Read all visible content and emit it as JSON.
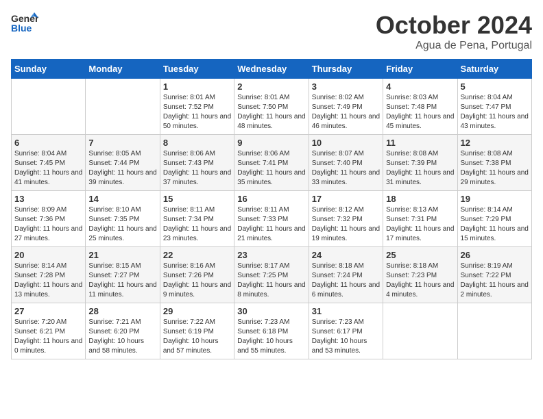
{
  "header": {
    "logo_general": "General",
    "logo_blue": "Blue",
    "month_title": "October 2024",
    "subtitle": "Agua de Pena, Portugal"
  },
  "days_of_week": [
    "Sunday",
    "Monday",
    "Tuesday",
    "Wednesday",
    "Thursday",
    "Friday",
    "Saturday"
  ],
  "weeks": [
    [
      {
        "day": "",
        "info": ""
      },
      {
        "day": "",
        "info": ""
      },
      {
        "day": "1",
        "info": "Sunrise: 8:01 AM\nSunset: 7:52 PM\nDaylight: 11 hours and 50 minutes."
      },
      {
        "day": "2",
        "info": "Sunrise: 8:01 AM\nSunset: 7:50 PM\nDaylight: 11 hours and 48 minutes."
      },
      {
        "day": "3",
        "info": "Sunrise: 8:02 AM\nSunset: 7:49 PM\nDaylight: 11 hours and 46 minutes."
      },
      {
        "day": "4",
        "info": "Sunrise: 8:03 AM\nSunset: 7:48 PM\nDaylight: 11 hours and 45 minutes."
      },
      {
        "day": "5",
        "info": "Sunrise: 8:04 AM\nSunset: 7:47 PM\nDaylight: 11 hours and 43 minutes."
      }
    ],
    [
      {
        "day": "6",
        "info": "Sunrise: 8:04 AM\nSunset: 7:45 PM\nDaylight: 11 hours and 41 minutes."
      },
      {
        "day": "7",
        "info": "Sunrise: 8:05 AM\nSunset: 7:44 PM\nDaylight: 11 hours and 39 minutes."
      },
      {
        "day": "8",
        "info": "Sunrise: 8:06 AM\nSunset: 7:43 PM\nDaylight: 11 hours and 37 minutes."
      },
      {
        "day": "9",
        "info": "Sunrise: 8:06 AM\nSunset: 7:41 PM\nDaylight: 11 hours and 35 minutes."
      },
      {
        "day": "10",
        "info": "Sunrise: 8:07 AM\nSunset: 7:40 PM\nDaylight: 11 hours and 33 minutes."
      },
      {
        "day": "11",
        "info": "Sunrise: 8:08 AM\nSunset: 7:39 PM\nDaylight: 11 hours and 31 minutes."
      },
      {
        "day": "12",
        "info": "Sunrise: 8:08 AM\nSunset: 7:38 PM\nDaylight: 11 hours and 29 minutes."
      }
    ],
    [
      {
        "day": "13",
        "info": "Sunrise: 8:09 AM\nSunset: 7:36 PM\nDaylight: 11 hours and 27 minutes."
      },
      {
        "day": "14",
        "info": "Sunrise: 8:10 AM\nSunset: 7:35 PM\nDaylight: 11 hours and 25 minutes."
      },
      {
        "day": "15",
        "info": "Sunrise: 8:11 AM\nSunset: 7:34 PM\nDaylight: 11 hours and 23 minutes."
      },
      {
        "day": "16",
        "info": "Sunrise: 8:11 AM\nSunset: 7:33 PM\nDaylight: 11 hours and 21 minutes."
      },
      {
        "day": "17",
        "info": "Sunrise: 8:12 AM\nSunset: 7:32 PM\nDaylight: 11 hours and 19 minutes."
      },
      {
        "day": "18",
        "info": "Sunrise: 8:13 AM\nSunset: 7:31 PM\nDaylight: 11 hours and 17 minutes."
      },
      {
        "day": "19",
        "info": "Sunrise: 8:14 AM\nSunset: 7:29 PM\nDaylight: 11 hours and 15 minutes."
      }
    ],
    [
      {
        "day": "20",
        "info": "Sunrise: 8:14 AM\nSunset: 7:28 PM\nDaylight: 11 hours and 13 minutes."
      },
      {
        "day": "21",
        "info": "Sunrise: 8:15 AM\nSunset: 7:27 PM\nDaylight: 11 hours and 11 minutes."
      },
      {
        "day": "22",
        "info": "Sunrise: 8:16 AM\nSunset: 7:26 PM\nDaylight: 11 hours and 9 minutes."
      },
      {
        "day": "23",
        "info": "Sunrise: 8:17 AM\nSunset: 7:25 PM\nDaylight: 11 hours and 8 minutes."
      },
      {
        "day": "24",
        "info": "Sunrise: 8:18 AM\nSunset: 7:24 PM\nDaylight: 11 hours and 6 minutes."
      },
      {
        "day": "25",
        "info": "Sunrise: 8:18 AM\nSunset: 7:23 PM\nDaylight: 11 hours and 4 minutes."
      },
      {
        "day": "26",
        "info": "Sunrise: 8:19 AM\nSunset: 7:22 PM\nDaylight: 11 hours and 2 minutes."
      }
    ],
    [
      {
        "day": "27",
        "info": "Sunrise: 7:20 AM\nSunset: 6:21 PM\nDaylight: 11 hours and 0 minutes."
      },
      {
        "day": "28",
        "info": "Sunrise: 7:21 AM\nSunset: 6:20 PM\nDaylight: 10 hours and 58 minutes."
      },
      {
        "day": "29",
        "info": "Sunrise: 7:22 AM\nSunset: 6:19 PM\nDaylight: 10 hours and 57 minutes."
      },
      {
        "day": "30",
        "info": "Sunrise: 7:23 AM\nSunset: 6:18 PM\nDaylight: 10 hours and 55 minutes."
      },
      {
        "day": "31",
        "info": "Sunrise: 7:23 AM\nSunset: 6:17 PM\nDaylight: 10 hours and 53 minutes."
      },
      {
        "day": "",
        "info": ""
      },
      {
        "day": "",
        "info": ""
      }
    ]
  ]
}
